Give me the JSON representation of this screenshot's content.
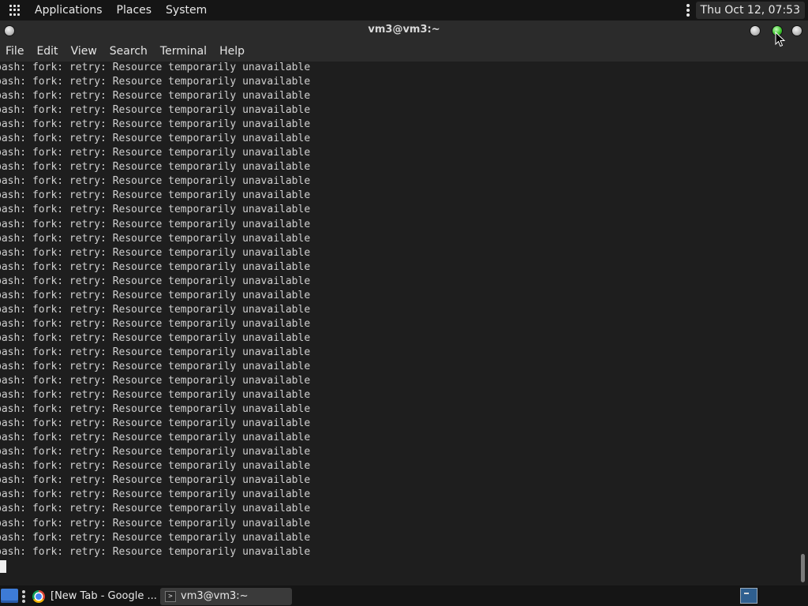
{
  "top_panel": {
    "menus": [
      "Applications",
      "Places",
      "System"
    ],
    "clock": "Thu Oct 12, 07:53"
  },
  "window": {
    "title": "vm3@vm3:~",
    "buttons": [
      "window-menu-icon",
      "minimize-icon",
      "maximize-icon",
      "close-icon"
    ],
    "maximize_color": "#3ec42e"
  },
  "menubar": {
    "items": [
      "File",
      "Edit",
      "View",
      "Search",
      "Terminal",
      "Help"
    ]
  },
  "terminal": {
    "lines": [
      "bash: fork: retry: Resource temporarily unavailable",
      "bash: fork: retry: Resource temporarily unavailable",
      "bash: fork: retry: Resource temporarily unavailable",
      "bash: fork: retry: Resource temporarily unavailable",
      "bash: fork: retry: Resource temporarily unavailable",
      "bash: fork: retry: Resource temporarily unavailable",
      "bash: fork: retry: Resource temporarily unavailable",
      "bash: fork: retry: Resource temporarily unavailable",
      "bash: fork: retry: Resource temporarily unavailable",
      "bash: fork: retry: Resource temporarily unavailable",
      "bash: fork: retry: Resource temporarily unavailable",
      "bash: fork: retry: Resource temporarily unavailable",
      "bash: fork: retry: Resource temporarily unavailable",
      "bash: fork: retry: Resource temporarily unavailable",
      "bash: fork: retry: Resource temporarily unavailable",
      "bash: fork: retry: Resource temporarily unavailable",
      "bash: fork: retry: Resource temporarily unavailable",
      "bash: fork: retry: Resource temporarily unavailable",
      "bash: fork: retry: Resource temporarily unavailable",
      "bash: fork: retry: Resource temporarily unavailable",
      "bash: fork: retry: Resource temporarily unavailable",
      "bash: fork: retry: Resource temporarily unavailable",
      "bash: fork: retry: Resource temporarily unavailable",
      "bash: fork: retry: Resource temporarily unavailable",
      "bash: fork: retry: Resource temporarily unavailable",
      "bash: fork: retry: Resource temporarily unavailable",
      "bash: fork: retry: Resource temporarily unavailable",
      "bash: fork: retry: Resource temporarily unavailable",
      "bash: fork: retry: Resource temporarily unavailable",
      "bash: fork: retry: Resource temporarily unavailable",
      "bash: fork: retry: Resource temporarily unavailable",
      "bash: fork: retry: Resource temporarily unavailable",
      "bash: fork: retry: Resource temporarily unavailable",
      "bash: fork: retry: Resource temporarily unavailable",
      "bash: fork: retry: Resource temporarily unavailable"
    ],
    "text_color": "#d0d0d0",
    "background": "#1e1e1e"
  },
  "taskbar": {
    "tasks": [
      {
        "label": "[New Tab - Google ...",
        "icon": "chrome-icon",
        "active": false
      },
      {
        "label": "vm3@vm3:~",
        "icon": "terminal-icon",
        "active": true
      }
    ]
  }
}
